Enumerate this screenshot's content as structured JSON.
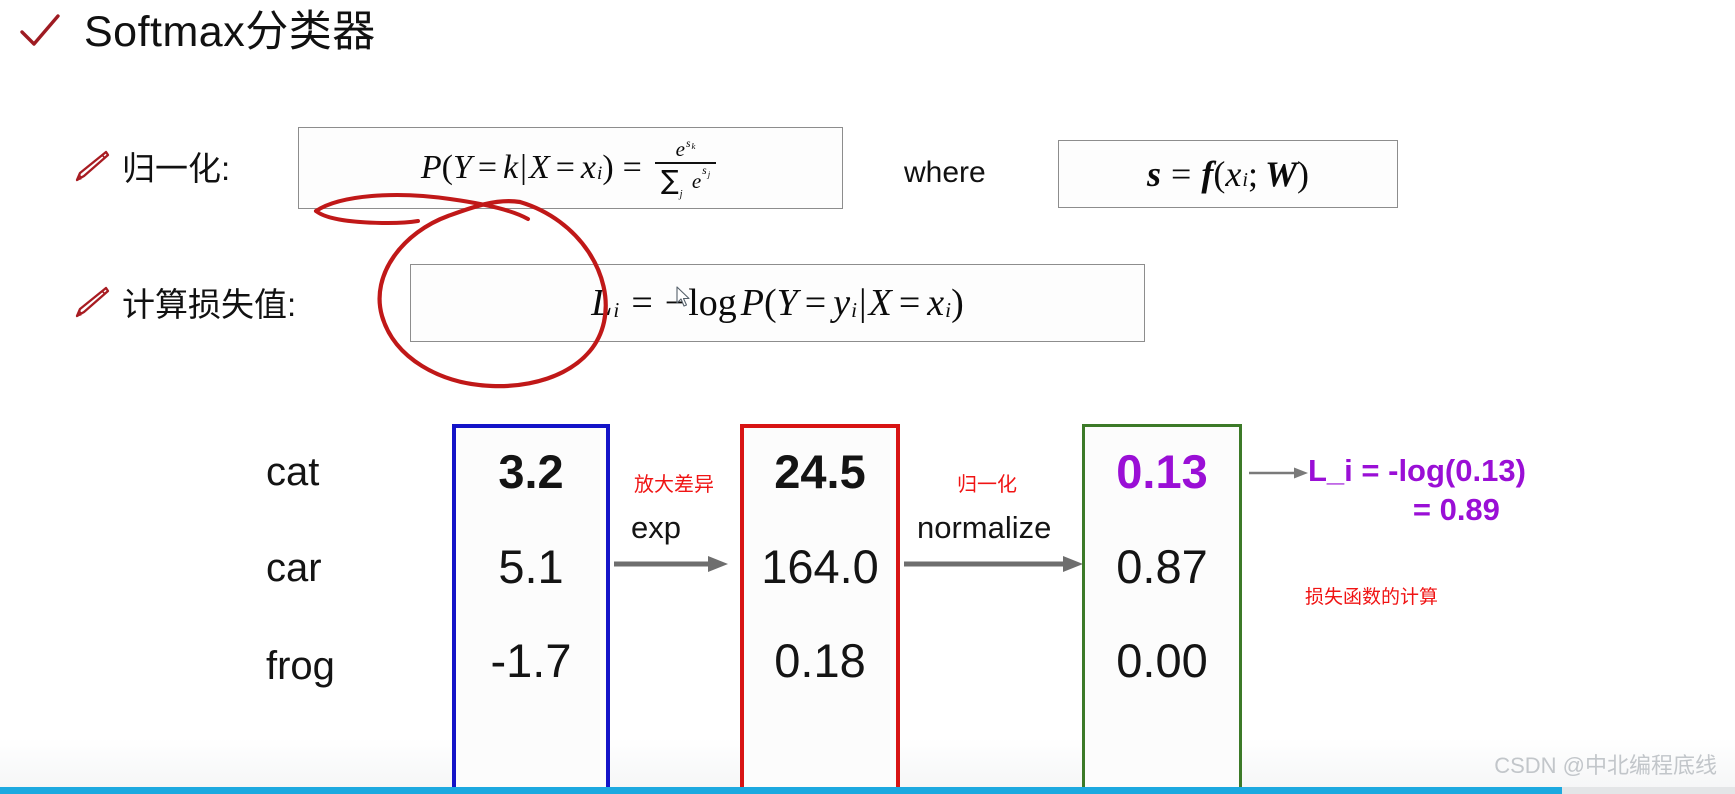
{
  "title": {
    "text": "Softmax分类器",
    "check_icon": "check-icon",
    "check_color": "#9e1b22"
  },
  "rows": [
    {
      "icon": "pencil-icon",
      "label": "归一化:",
      "formula": "P(Y = k|X = x_i) = e^{s_k} / Σ_j e^{s_j}",
      "where_label": "where",
      "where_formula": "s = f(x_i; W)"
    },
    {
      "icon": "pencil-icon",
      "label": "计算损失值:",
      "formula": "L_i = −log P(Y = y_i|X = x_i)"
    }
  ],
  "formula_parts": {
    "p_open": "P(Y",
    "eq": "=",
    "k": "k",
    "bar": "|",
    "X": "X",
    "xi": "x",
    "i": "i",
    "close": ")",
    "num_e": "e",
    "num_s": "s",
    "num_k": "k",
    "den_sum": "∑",
    "den_j": "j",
    "den_e": "e",
    "den_s": "s",
    "den_j2": "j",
    "s": "s",
    "f": "f",
    "semi": ";",
    "W": "W",
    "L": "L",
    "minus": "−",
    "log": "log",
    "y": "y"
  },
  "annotations": {
    "ink_color": "#c01818",
    "ink_shapes": [
      "underline-squiggle",
      "oval-circle"
    ]
  },
  "diagram": {
    "class_labels": [
      "cat",
      "car",
      "frog"
    ],
    "columns": [
      {
        "name": "scores",
        "border_color": "#1414c8",
        "values": [
          "3.2",
          "5.1",
          "-1.7"
        ],
        "highlight_index": 0,
        "highlight_style": "bold"
      },
      {
        "name": "unnormalized-probabilities",
        "border_color": "#d81414",
        "values": [
          "24.5",
          "164.0",
          "0.18"
        ],
        "highlight_index": 0,
        "highlight_style": "bold"
      },
      {
        "name": "probabilities",
        "border_color": "#3c7a28",
        "values": [
          "0.13",
          "0.87",
          "0.00"
        ],
        "highlight_index": 0,
        "highlight_style": "purple"
      }
    ],
    "transforms": [
      {
        "cn": "放大差异",
        "en": "exp"
      },
      {
        "cn": "归一化",
        "en": "normalize"
      }
    ],
    "result": {
      "line1": "L_i = -log(0.13)",
      "line2": "= 0.89",
      "color": "#9a0fd6"
    },
    "note": "损失函数的计算",
    "note_color": "#f01414"
  },
  "footer": {
    "watermark": "CSDN @中北编程底线",
    "progress_percent": 90,
    "progress_color": "#1ca9e0"
  }
}
